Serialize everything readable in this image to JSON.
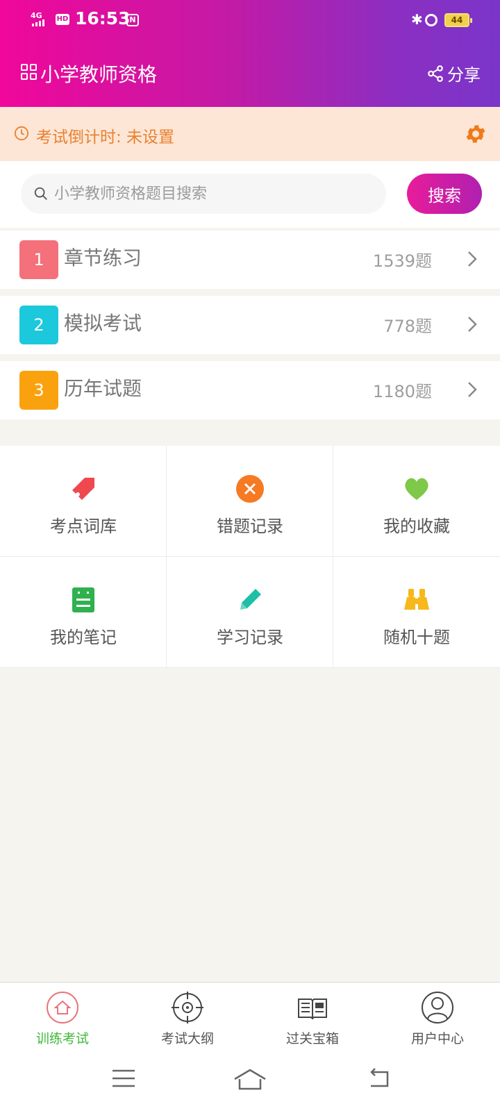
{
  "status_bar": {
    "network": "4G",
    "hd": "HD",
    "time": "16:53",
    "battery": "44"
  },
  "app": {
    "title": "小学教师资格",
    "share_label": "分享"
  },
  "countdown": {
    "label": "考试倒计时: 未设置"
  },
  "search": {
    "placeholder": "小学教师资格题目搜索",
    "button_label": "搜索"
  },
  "practice_items": [
    {
      "num": "1",
      "name": "章节练习",
      "count": "1539题",
      "color": "#f4707a"
    },
    {
      "num": "2",
      "name": "模拟考试",
      "count": "778题",
      "color": "#1cc8dc"
    },
    {
      "num": "3",
      "name": "历年试题",
      "count": "1180题",
      "color": "#f9a20e"
    }
  ],
  "features": [
    {
      "label": "考点词库",
      "icon": "tag-icon",
      "color": "#f0484f"
    },
    {
      "label": "错题记录",
      "icon": "close-circle-icon",
      "color": "#f57a22"
    },
    {
      "label": "我的收藏",
      "icon": "heart-icon",
      "color": "#7ec84a"
    },
    {
      "label": "我的笔记",
      "icon": "notebook-icon",
      "color": "#2fb14e"
    },
    {
      "label": "学习记录",
      "icon": "pencil-icon",
      "color": "#1dbfa6"
    },
    {
      "label": "随机十题",
      "icon": "binoculars-icon",
      "color": "#f6b81a"
    }
  ],
  "tabs": [
    {
      "label": "训练考试",
      "icon": "home-icon",
      "active": true
    },
    {
      "label": "考试大纲",
      "icon": "target-icon",
      "active": false
    },
    {
      "label": "过关宝箱",
      "icon": "news-book-icon",
      "active": false
    },
    {
      "label": "用户中心",
      "icon": "user-icon",
      "active": false
    }
  ],
  "colors": {
    "header_gradient_start": "#f0079a",
    "header_gradient_end": "#7b35c9",
    "countdown_bg": "#fde6d6",
    "countdown_text": "#e9812f",
    "active_tab": "#3fb83a",
    "page_bg": "#f6f4ee"
  }
}
